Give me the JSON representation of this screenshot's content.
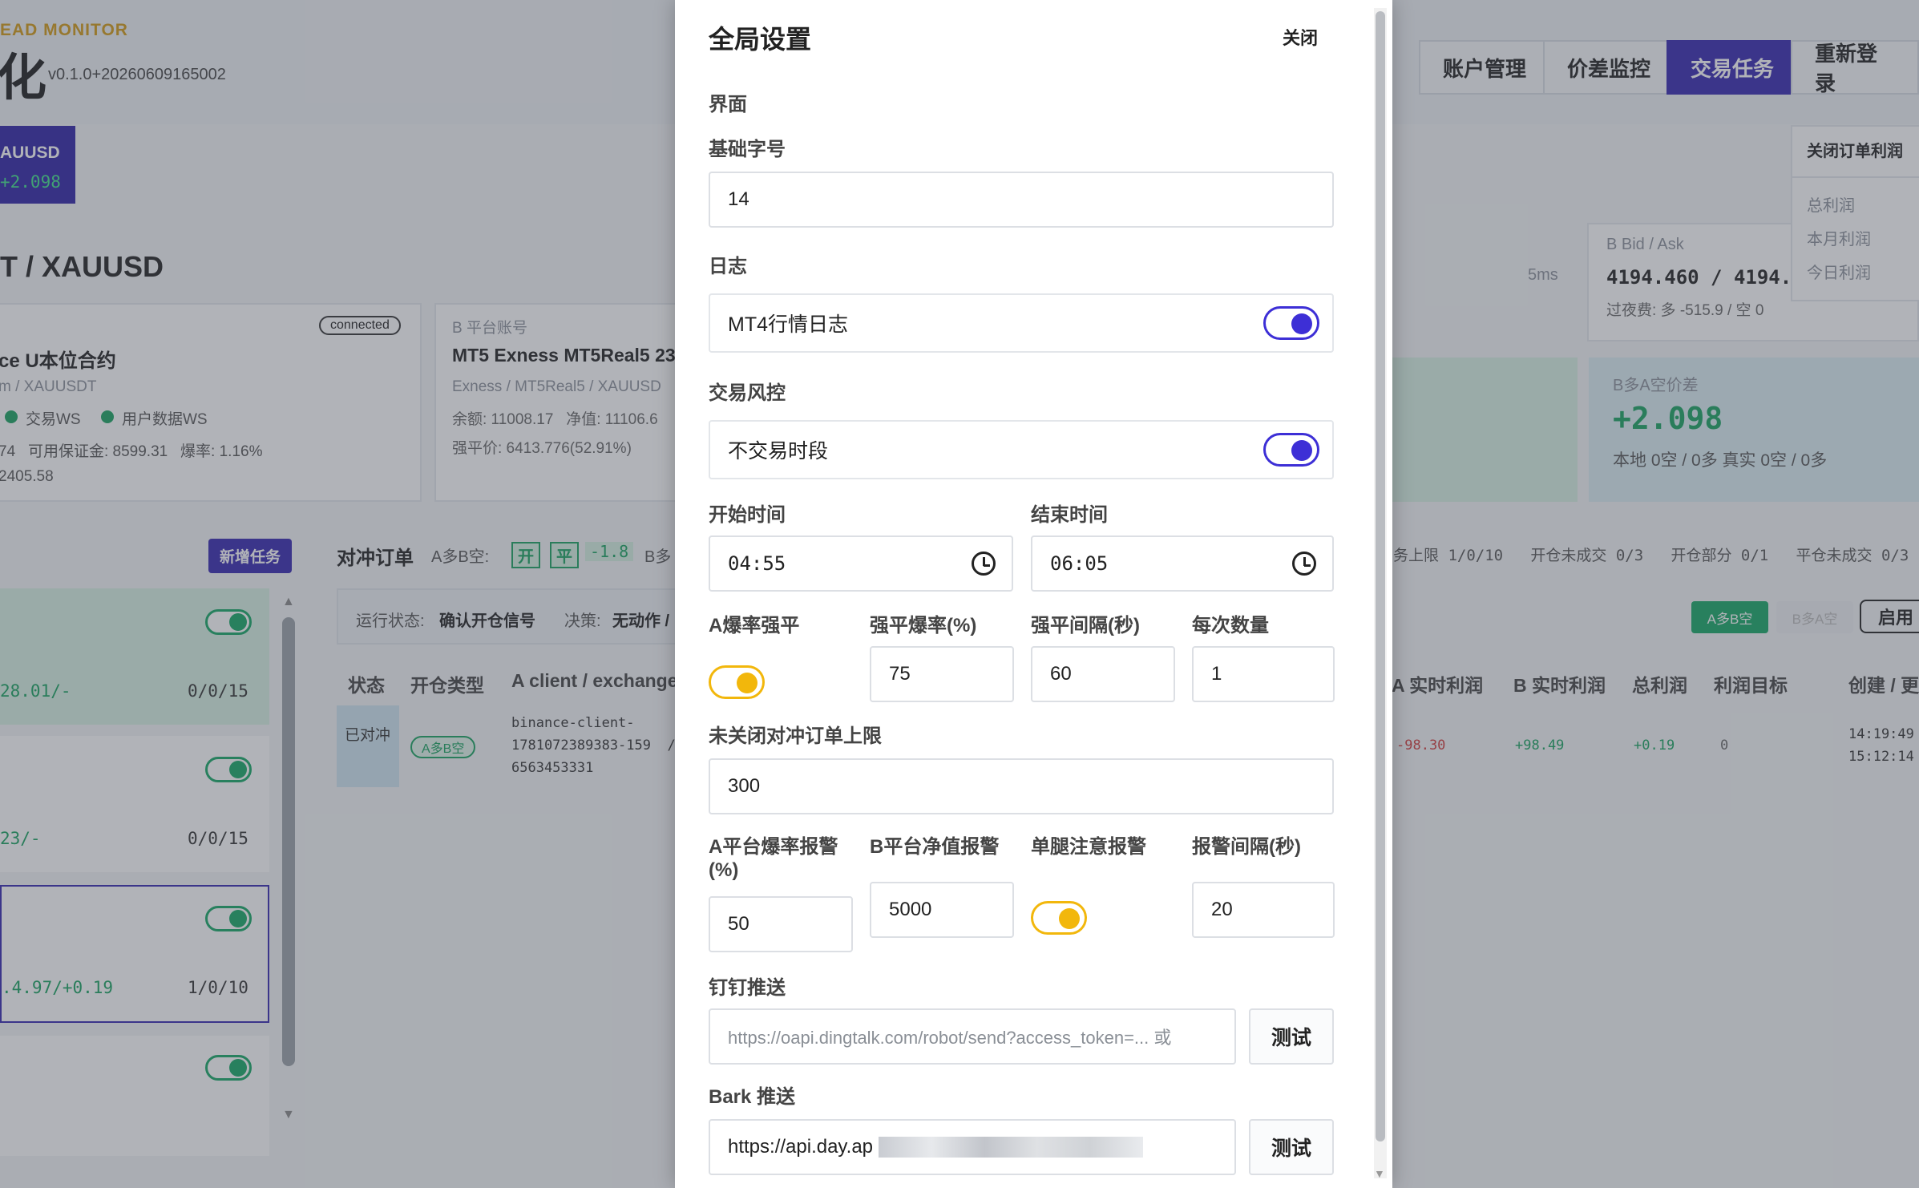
{
  "app": {
    "brand_sub": "EAD MONITOR",
    "brand_main": "化",
    "version": "v0.1.0+20260609165002",
    "nav": [
      {
        "label": "账户管理"
      },
      {
        "label": "价差监控"
      },
      {
        "label": "交易任务",
        "active": true
      },
      {
        "label": "重新登录"
      }
    ],
    "symbol_tab": {
      "name": "AUUSD",
      "value": "+2.098"
    },
    "page_title": "T / XAUUSD",
    "a_card": {
      "badge": "connected",
      "title": "ce U本位合约",
      "sub": "m / XAUUSDT",
      "ws1": "交易WS",
      "ws2": "用户数据WS",
      "line1": "74   可用保证金: 8599.31   爆率: 1.16%",
      "line2": "2405.58"
    },
    "b_card": {
      "label": "B 平台账号",
      "title": "MT5 Exness MT5Real5 23",
      "sub": "Exness / MT5Real5 / XAUUSD",
      "line1": "余额: 11008.17   净值: 11106.6",
      "line2": "强平价: 6413.776(52.91%)"
    },
    "latency": "5ms",
    "bidask_label": "B Bid / Ask",
    "bidask_value": "4194.460 / 4194.6",
    "swap_line": "过夜费: 多 -515.9 / 空 0",
    "profit_menu": {
      "title": "关闭订单利润",
      "items": [
        "总利润",
        "本月利润",
        "今日利润"
      ]
    },
    "spread_card": {
      "label": "B多A空价差",
      "value": "+2.098",
      "sub": "本地 0空 / 0多 真实 0空 / 0多"
    },
    "add_task": "新增任务",
    "tasks": [
      {
        "left": "28.01/-",
        "right": "0/0/15"
      },
      {
        "left": "23/-",
        "right": "0/0/15"
      },
      {
        "left": ".4.97/+0.19",
        "right": "1/0/10"
      },
      {
        "left": "",
        "right": ""
      }
    ],
    "hedge_title": "对冲订单",
    "hedge_dir": "A多B空:",
    "hedge_open": "开",
    "hedge_close": "平",
    "hedge_val": "-1.8",
    "hedge_b": "B多",
    "run_status_label": "运行状态:",
    "run_status": "确认开仓信号",
    "decision_label": "决策:",
    "decision": "无动作 /",
    "stats": "务上限 1/0/10   开仓未成交 0/3   开仓部分 0/1   平仓未成交 0/3",
    "btn_ab": "A多B空",
    "btn_ba": "B多A空",
    "btn_enable": "启用",
    "table_headers_left": [
      "状态",
      "开仓类型",
      "A client / exchange"
    ],
    "table_headers_right": [
      "A 实时利润",
      "B 实时利润",
      "总利润",
      "利润目标",
      "创建 / 更"
    ],
    "table_row": {
      "status": "已对冲",
      "type": "A多B空",
      "client": "binance-client-",
      "client2": "1781072389383-159  /",
      "client3": "6563453331",
      "a_profit": "-98.30",
      "b_profit": "+98.49",
      "total": "+0.19",
      "target": "0",
      "time1": "14:19:49",
      "time2": "15:12:14"
    }
  },
  "modal": {
    "title": "全局设置",
    "close": "关闭",
    "section_ui": "界面",
    "font_size_label": "基础字号",
    "font_size": "14",
    "section_log": "日志",
    "mt4_log_label": "MT4行情日志",
    "mt4_log_on": true,
    "section_risk": "交易风控",
    "no_trade_label": "不交易时段",
    "no_trade_on": true,
    "start_label": "开始时间",
    "start": "04:55",
    "end_label": "结束时间",
    "end": "06:05",
    "liq_label": "A爆率强平",
    "liq_on": true,
    "liq_rate_label": "强平爆率(%)",
    "liq_rate": "75",
    "liq_interval_label": "强平间隔(秒)",
    "liq_interval": "60",
    "qty_label": "每次数量",
    "qty": "1",
    "max_open_label": "未关闭对冲订单上限",
    "max_open": "300",
    "a_alert_label": "A平台爆率报警",
    "a_alert_label2": "(%)",
    "a_alert": "50",
    "b_alert_label": "B平台净值报警",
    "b_alert": "5000",
    "single_leg_label": "单腿注意报警",
    "single_leg_on": true,
    "alert_interval_label": "报警间隔(秒)",
    "alert_interval": "20",
    "dingtalk_label": "钉钉推送",
    "dingtalk_placeholder": "https://oapi.dingtalk.com/robot/send?access_token=... 或",
    "dingtalk_test": "测试",
    "bark_label": "Bark 推送",
    "bark_value": "https://api.day.ap",
    "bark_test": "测试"
  },
  "colors": {
    "accent": "#3527b0",
    "toggle_blue": "#3d2fd6",
    "toggle_yellow": "#f2b70c",
    "green": "#17a35f"
  }
}
